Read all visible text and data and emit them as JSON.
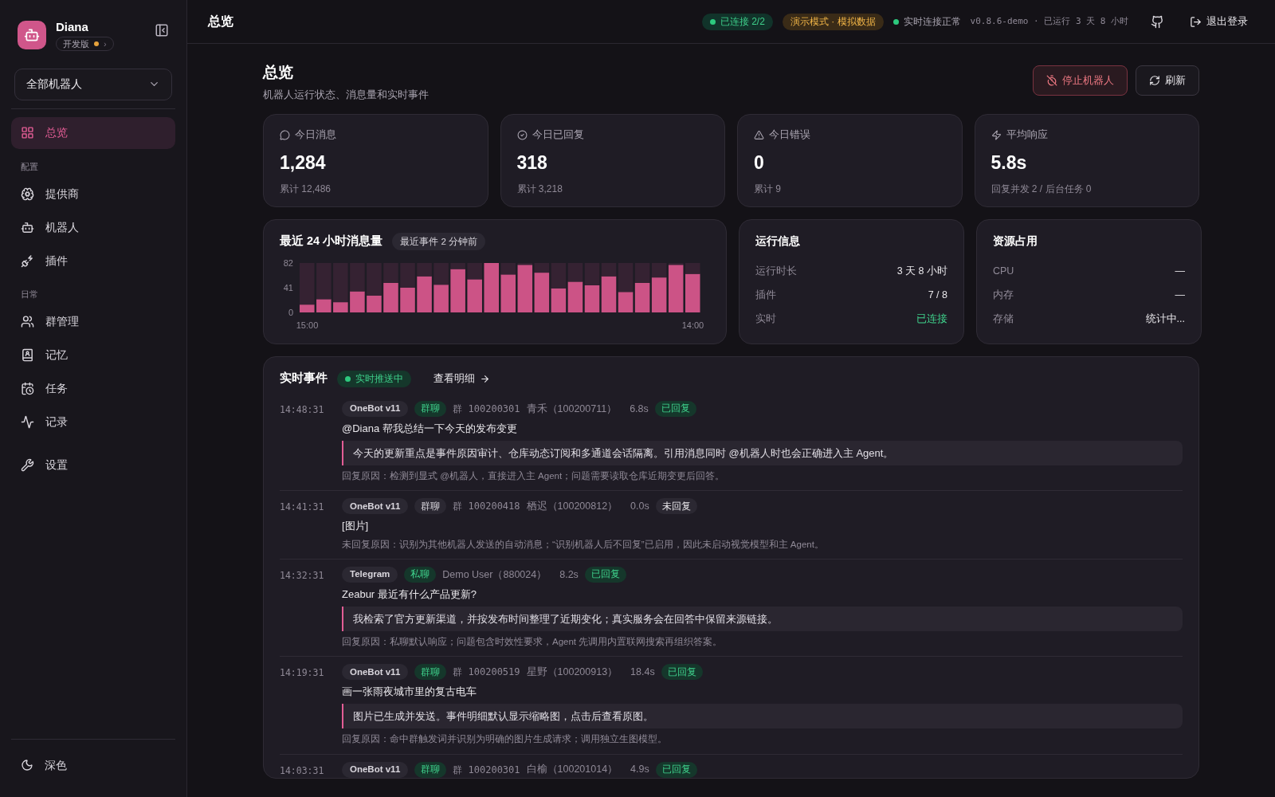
{
  "brand": {
    "name": "Diana",
    "edition": "开发版",
    "chevron": "›"
  },
  "bot_select": {
    "value": "全部机器人"
  },
  "sidebar": {
    "groups": [
      {
        "items": [
          {
            "label": "总览",
            "selected": true
          }
        ]
      },
      {
        "heading": "配置",
        "items": [
          {
            "label": "提供商",
            "selected": false
          },
          {
            "label": "机器人",
            "selected": false
          },
          {
            "label": "插件",
            "selected": false
          }
        ]
      },
      {
        "heading": "日常",
        "items": [
          {
            "label": "群管理",
            "selected": false
          },
          {
            "label": "记忆",
            "selected": false
          },
          {
            "label": "任务",
            "selected": false
          },
          {
            "label": "记录",
            "selected": false
          }
        ]
      },
      {
        "items": [
          {
            "label": "设置",
            "selected": false
          }
        ]
      }
    ],
    "theme_toggle": "深色"
  },
  "header": {
    "title": "总览",
    "connection": "已连接 2/2",
    "demo": "演示模式 · 模拟数据",
    "realtime": "实时连接正常",
    "version": "v0.8.6-demo · 已运行 3 天 8 小时",
    "logout": "退出登录"
  },
  "page": {
    "title": "总览",
    "subtitle": "机器人运行状态、消息量和实时事件",
    "actions": [
      {
        "label": "停止机器人",
        "kind": "danger"
      },
      {
        "label": "刷新",
        "kind": "default"
      }
    ]
  },
  "stats": [
    {
      "label": "今日消息",
      "value": "1,284",
      "sub": "累计 12,486"
    },
    {
      "label": "今日已回复",
      "value": "318",
      "sub": "累计 3,218"
    },
    {
      "label": "今日错误",
      "value": "0",
      "sub": "累计 9"
    },
    {
      "label": "平均响应",
      "value": "5.8s",
      "sub": "回复并发 2 / 后台任务 0"
    }
  ],
  "volume": {
    "title": "最近 24 小时消息量",
    "badge": "最近事件 2 分钟前",
    "chart_data": {
      "type": "bar",
      "stacked": true,
      "series": [
        {
          "color": "#cc5386",
          "values": [
            13,
            22,
            17,
            35,
            28,
            49,
            41,
            60,
            46,
            72,
            55,
            82,
            63,
            79,
            66,
            40,
            51,
            45,
            60,
            34,
            49,
            58,
            79,
            64
          ]
        },
        {
          "color": "#352232",
          "values": [
            69,
            60,
            65,
            47,
            54,
            33,
            41,
            22,
            36,
            10,
            27,
            0,
            19,
            3,
            16,
            42,
            31,
            37,
            22,
            48,
            33,
            24,
            3,
            18
          ]
        }
      ],
      "ylim": [
        0,
        82
      ],
      "yticks": [
        0,
        41,
        82
      ],
      "categories": [
        "15:00",
        null,
        null,
        null,
        null,
        null,
        null,
        null,
        null,
        null,
        null,
        null,
        null,
        null,
        null,
        null,
        null,
        null,
        null,
        null,
        null,
        null,
        null,
        "14:00"
      ]
    }
  },
  "run_info": {
    "title": "运行信息",
    "rows": [
      {
        "label": "运行时长",
        "value": "3 天 8 小时",
        "kind": "text"
      },
      {
        "label": "插件",
        "value": "7 / 8",
        "kind": "text"
      },
      {
        "label": "实时",
        "value": "已连接",
        "kind": "status"
      }
    ]
  },
  "resources": {
    "title": "资源占用",
    "rows": [
      {
        "label": "CPU",
        "value": "—",
        "kind": "text"
      },
      {
        "label": "内存",
        "value": "—",
        "kind": "text"
      },
      {
        "label": "存储",
        "value": "统计中...",
        "kind": "text"
      }
    ]
  },
  "events": {
    "title": "实时事件",
    "live": "实时推送中",
    "details_link": "查看明细",
    "items": [
      {
        "time": "14:48:31",
        "platform": "OneBot v11",
        "chat": {
          "label": "群聊",
          "kind": "group"
        },
        "group": "群 100200301",
        "sender": "青禾（100200711）",
        "duration": "6.8s",
        "status": {
          "label": "已回复",
          "replied": true
        },
        "message": "@Diana 帮我总结一下今天的发布变更",
        "reply": "今天的更新重点是事件原因审计、仓库动态订阅和多通道会话隔离。引用消息同时 @机器人时也会正确进入主 Agent。",
        "reason": "回复原因：检测到显式 @机器人，直接进入主 Agent；问题需要读取仓库近期变更后回答。"
      },
      {
        "time": "14:41:31",
        "platform": "OneBot v11",
        "chat": {
          "label": "群聊",
          "kind": "muted"
        },
        "group": "群 100200418",
        "sender": "栖迟（100200812）",
        "duration": "0.0s",
        "status": {
          "label": "未回复",
          "replied": false
        },
        "message": "[图片]",
        "reason": "未回复原因：识别为其他机器人发送的自动消息；“识别机器人后不回复”已启用，因此未启动视觉模型和主 Agent。"
      },
      {
        "time": "14:32:31",
        "platform": "Telegram",
        "chat": {
          "label": "私聊",
          "kind": "group"
        },
        "sender": "Demo User（880024）",
        "duration": "8.2s",
        "status": {
          "label": "已回复",
          "replied": true
        },
        "message": "Zeabur 最近有什么产品更新?",
        "reply": "我检索了官方更新渠道，并按发布时间整理了近期变化；真实服务会在回答中保留来源链接。",
        "reason": "回复原因：私聊默认响应；问题包含时效性要求，Agent 先调用内置联网搜索再组织答案。"
      },
      {
        "time": "14:19:31",
        "platform": "OneBot v11",
        "chat": {
          "label": "群聊",
          "kind": "group"
        },
        "group": "群 100200519",
        "sender": "星野（100200913）",
        "duration": "18.4s",
        "status": {
          "label": "已回复",
          "replied": true
        },
        "message": "画一张雨夜城市里的复古电车",
        "reply": "图片已生成并发送。事件明细默认显示缩略图，点击后查看原图。",
        "reason": "回复原因：命中群触发词并识别为明确的图片生成请求；调用独立生图模型。"
      },
      {
        "time": "14:03:31",
        "platform": "OneBot v11",
        "chat": {
          "label": "群聊",
          "kind": "group"
        },
        "group": "群 100200301",
        "sender": "白榆（100201014）",
        "duration": "4.9s",
        "status": {
          "label": "已回复",
          "replied": true
        }
      }
    ]
  }
}
